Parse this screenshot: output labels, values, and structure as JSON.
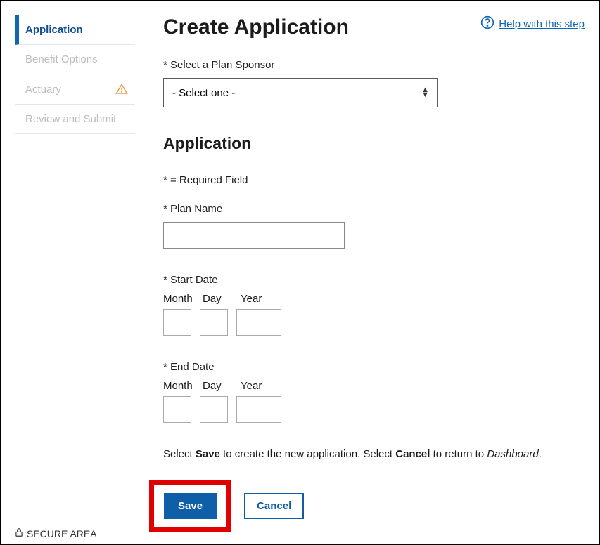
{
  "sidebar": {
    "items": [
      {
        "label": "Application",
        "active": true
      },
      {
        "label": "Benefit Options"
      },
      {
        "label": "Actuary",
        "warn": true
      },
      {
        "label": "Review and Submit"
      }
    ]
  },
  "header": {
    "title": "Create Application",
    "help_label": "Help with this step"
  },
  "sponsor": {
    "label": "* Select a Plan Sponsor",
    "placeholder": "- Select one -"
  },
  "section": {
    "heading": "Application",
    "required_note": "* = Required Field"
  },
  "plan_name": {
    "label": "* Plan Name",
    "value": ""
  },
  "start_date": {
    "label": "* Start Date",
    "month_label": "Month",
    "day_label": "Day",
    "year_label": "Year"
  },
  "end_date": {
    "label": "* End Date",
    "month_label": "Month",
    "day_label": "Day",
    "year_label": "Year"
  },
  "instruction": {
    "pre1": "Select ",
    "b1": "Save",
    "mid1": " to create the new application. Select ",
    "b2": "Cancel",
    "mid2": " to return to ",
    "i1": "Dashboard",
    "post": "."
  },
  "buttons": {
    "save": "Save",
    "cancel": "Cancel"
  },
  "footer": {
    "secure": "SECURE AREA"
  }
}
